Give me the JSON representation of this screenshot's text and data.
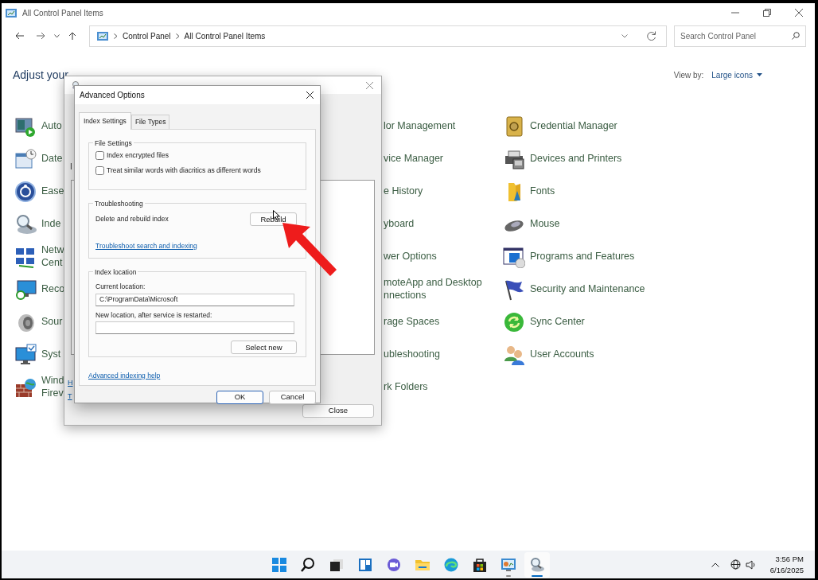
{
  "window": {
    "title": "All Control Panel Items"
  },
  "address_bar": {
    "breadcrumbs": [
      "Control Panel",
      "All Control Panel Items"
    ]
  },
  "search": {
    "placeholder": "Search Control Panel"
  },
  "heading": "Adjust your",
  "view_by": {
    "label": "View by:",
    "value": "Large icons"
  },
  "items_left": [
    {
      "lines": [
        "Auto"
      ]
    },
    {
      "lines": [
        "Date"
      ]
    },
    {
      "lines": [
        "Ease"
      ]
    },
    {
      "lines": [
        "Inde"
      ]
    },
    {
      "lines": [
        "Netw",
        "Cent"
      ]
    },
    {
      "lines": [
        "Reco"
      ]
    },
    {
      "lines": [
        "Sour"
      ]
    },
    {
      "lines": [
        "Syst"
      ]
    },
    {
      "lines": [
        "Wind",
        "Firev"
      ]
    }
  ],
  "items_middle": [
    {
      "lines": [
        "lor Management"
      ]
    },
    {
      "lines": [
        "vice Manager"
      ]
    },
    {
      "lines": [
        "e History"
      ]
    },
    {
      "lines": [
        "yboard"
      ]
    },
    {
      "lines": [
        "wer Options"
      ]
    },
    {
      "lines": [
        "moteApp and Desktop",
        "nnections"
      ]
    },
    {
      "lines": [
        "rage Spaces"
      ]
    },
    {
      "lines": [
        "ubleshooting"
      ]
    },
    {
      "lines": [
        "rk Folders"
      ]
    }
  ],
  "items_right": [
    {
      "lines": [
        "Credential Manager"
      ]
    },
    {
      "lines": [
        "Devices and Printers"
      ]
    },
    {
      "lines": [
        "Fonts"
      ]
    },
    {
      "lines": [
        "Mouse"
      ]
    },
    {
      "lines": [
        "Programs and Features"
      ]
    },
    {
      "lines": [
        "Security and Maintenance"
      ]
    },
    {
      "lines": [
        "Sync Center"
      ]
    },
    {
      "lines": [
        "User Accounts"
      ]
    }
  ],
  "indexing_window": {
    "label_fragment": "I",
    "link_fragments": [
      "H",
      "T"
    ],
    "close_button": "Close"
  },
  "advanced_dialog": {
    "title": "Advanced Options",
    "tabs": [
      {
        "label": "Index Settings",
        "selected": true
      },
      {
        "label": "File Types",
        "selected": false
      }
    ],
    "file_settings": {
      "legend": "File Settings",
      "options": [
        {
          "label": "Index encrypted files",
          "checked": false
        },
        {
          "label": "Treat similar words with diacritics as different words",
          "checked": false
        }
      ]
    },
    "troubleshooting": {
      "legend": "Troubleshooting",
      "text": "Delete and rebuild index",
      "button": "Rebuild",
      "link": "Troubleshoot search and indexing"
    },
    "index_location": {
      "legend": "Index location",
      "current_label": "Current location:",
      "current_value": "C:\\ProgramData\\Microsoft",
      "new_label": "New location, after service is restarted:",
      "select_button": "Select new"
    },
    "help_link": "Advanced indexing help",
    "buttons": [
      "OK",
      "Cancel"
    ]
  },
  "taskbar": {
    "apps": [
      {
        "running": false,
        "active": false
      },
      {
        "running": false,
        "active": false
      },
      {
        "running": false,
        "active": false
      },
      {
        "running": false,
        "active": false
      },
      {
        "running": false,
        "active": false
      },
      {
        "running": false,
        "active": false
      },
      {
        "running": false,
        "active": false
      },
      {
        "running": false,
        "active": false
      },
      {
        "running": true,
        "active": false
      },
      {
        "running": true,
        "active": true
      }
    ]
  },
  "clock": {
    "time": "3:56 PM",
    "date": "6/16/2025"
  }
}
